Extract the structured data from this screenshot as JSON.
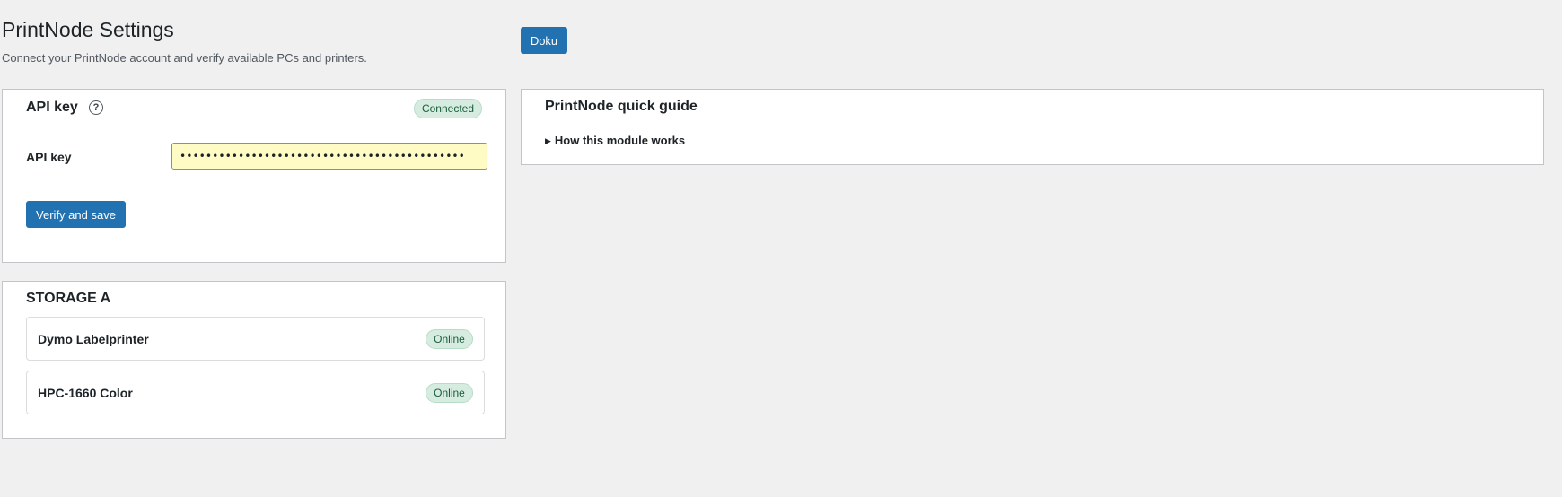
{
  "header": {
    "title": "PrintNode Settings",
    "subtitle": "Connect your PrintNode account and verify available PCs and printers.",
    "doku_label": "Doku"
  },
  "api_card": {
    "heading": "API key",
    "help_glyph": "?",
    "help_icon": "question-circle-icon",
    "status": "Connected",
    "field_label": "API key",
    "field_value": "••••••••••••••••••••••••••••••••••••••••••••",
    "verify_label": "Verify and save"
  },
  "guide_card": {
    "heading": "PrintNode quick guide",
    "details_glyph": "▶",
    "details_summary": "How this module works"
  },
  "storage": {
    "heading": "STORAGE A",
    "printers": [
      {
        "name": "Dymo Labelprinter",
        "status": "Online"
      },
      {
        "name": "HPC-1660 Color",
        "status": "Online"
      }
    ]
  },
  "colors": {
    "accent": "#2271b1",
    "status_bg": "#d6ece1",
    "status_text": "#1b5e3b",
    "input_bg": "#fefbc4"
  }
}
